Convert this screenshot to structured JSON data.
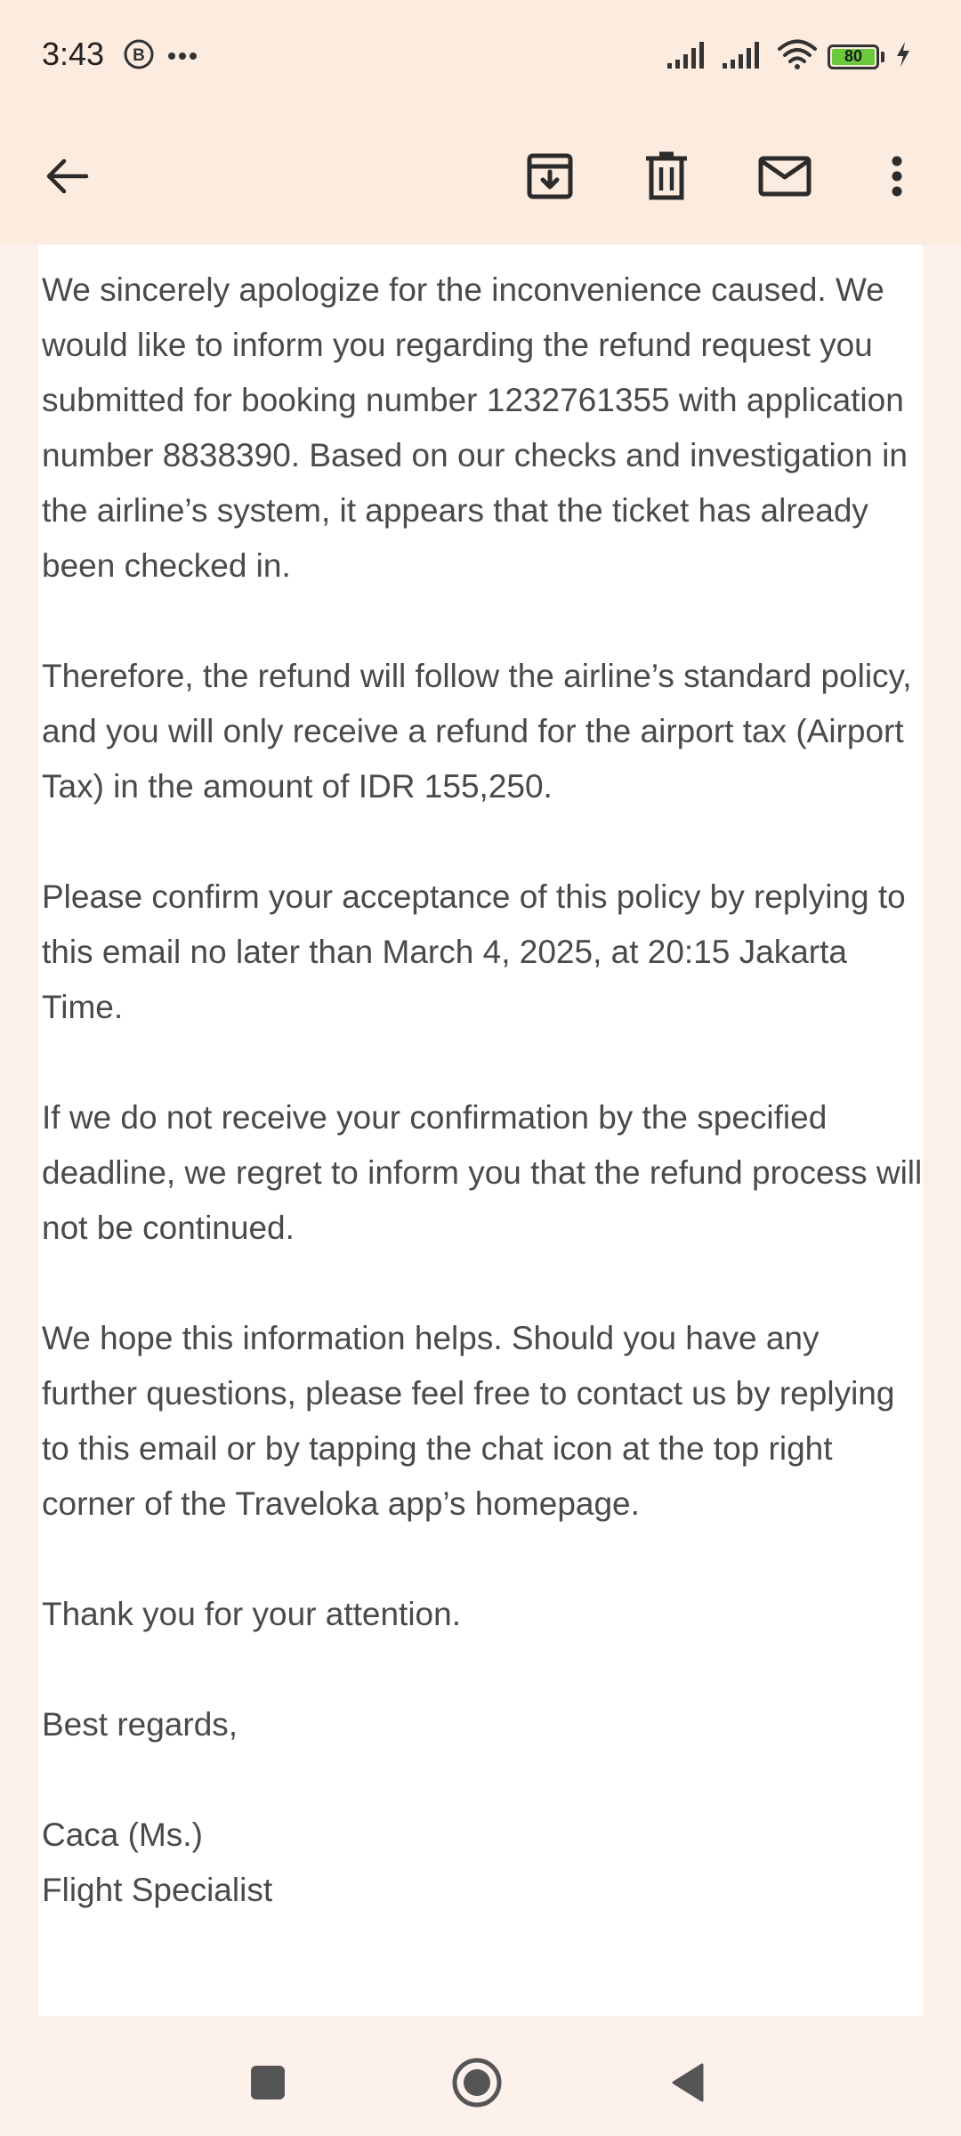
{
  "status_bar": {
    "time": "3:43",
    "battery_level": "80",
    "icons": [
      "b-badge-icon",
      "more-dots-icon",
      "signal-icon",
      "signal-icon",
      "wifi-icon",
      "battery-icon",
      "charging-bolt-icon"
    ]
  },
  "toolbar": {
    "icons": [
      "back-arrow-icon",
      "archive-icon",
      "delete-icon",
      "mark-unread-icon",
      "more-vert-icon"
    ]
  },
  "email": {
    "paragraphs": [
      "We sincerely apologize for the inconvenience caused. We would like to inform you regarding the refund request you submitted for booking number 1232761355 with application number 8838390. Based on our checks and investigation in the airline’s system, it appears that the ticket has already been checked in.",
      "Therefore, the refund will follow the airline’s standard policy, and you will only receive a refund for the airport tax (Airport Tax) in the amount of IDR 155,250.",
      "Please confirm your acceptance of this policy by replying to this email no later than March 4, 2025, at 20:15 Jakarta Time.",
      "If we do not receive your confirmation by the specified deadline, we regret to inform you that the refund process will not be continued.",
      "We hope this information helps. Should you have any further questions, please feel free to contact us by replying to this email or by tapping the chat icon at the top right corner of the Traveloka app’s homepage.",
      "Thank you for your attention.",
      "Best regards,"
    ],
    "signature_name": "Caca (Ms.)",
    "signature_title": "Flight Specialist"
  },
  "nav_bar": {
    "icons": [
      "recents-square-icon",
      "home-circle-icon",
      "back-triangle-icon"
    ]
  },
  "colors": {
    "header_bg": "#fcebdf",
    "page_bg": "#fdf1ec",
    "text": "#4a4a4a",
    "battery_fill": "#6cc83c"
  }
}
